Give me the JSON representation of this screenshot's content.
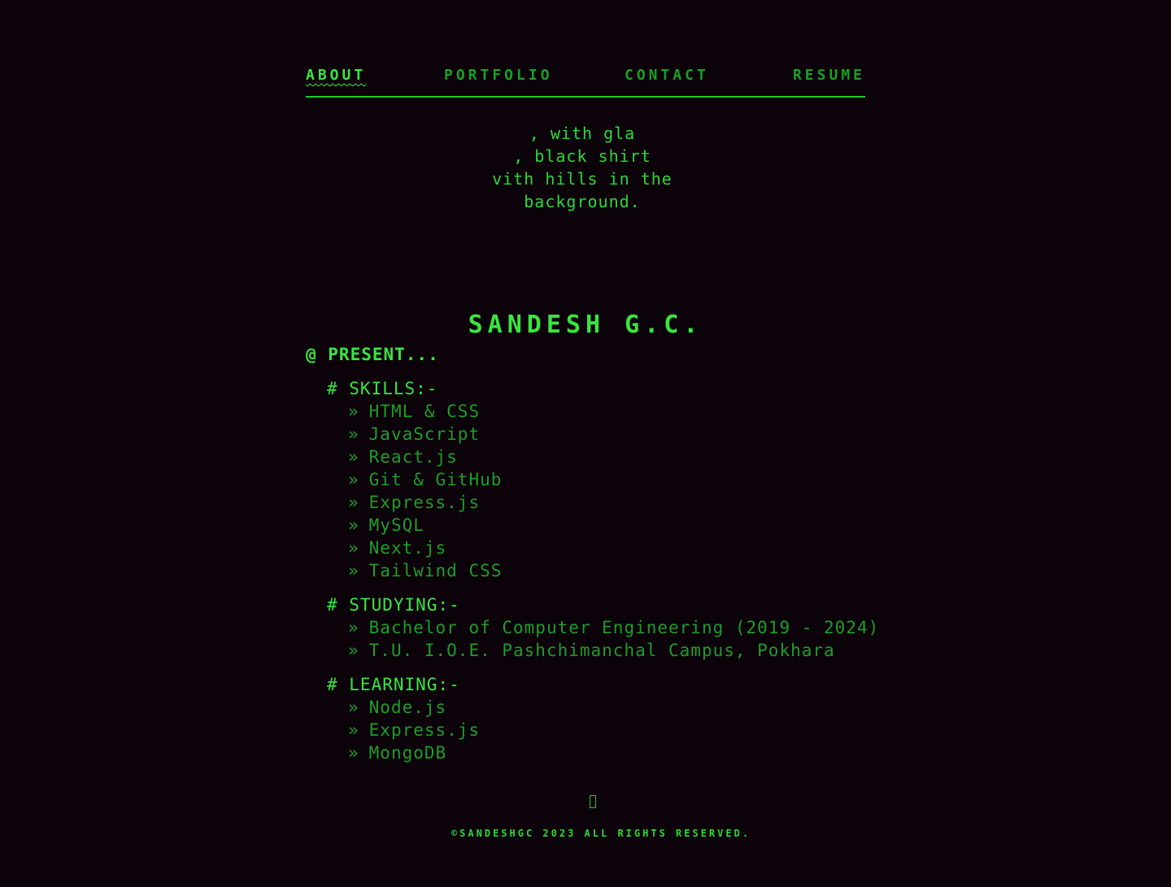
{
  "nav": {
    "items": [
      {
        "label": "ABOUT",
        "active": true
      },
      {
        "label": "PORTFOLIO",
        "active": false
      },
      {
        "label": "CONTACT",
        "active": false
      },
      {
        "label": "RESUME",
        "active": false
      }
    ]
  },
  "profile": {
    "image_alt_lines": [
      ", with gla",
      ", black shirt",
      "vith hills in the",
      "background."
    ],
    "name": "SANDESH G.C."
  },
  "present_heading": "@ PRESENT...",
  "skills": {
    "title": "# SKILLS:-",
    "items": [
      "HTML & CSS",
      "JavaScript",
      "React.js",
      "Git & GitHub",
      "Express.js",
      "MySQL",
      "Next.js",
      "Tailwind CSS"
    ]
  },
  "studying": {
    "title": "# STUDYING:-",
    "items": [
      "Bachelor of Computer Engineering (2019 - 2024)",
      "T.U. I.O.E. Pashchimanchal Campus, Pokhara"
    ]
  },
  "learning": {
    "title": "# LEARNING:-",
    "items": [
      "Node.js",
      "Express.js",
      "MongoDB"
    ]
  },
  "bullet": "»",
  "footer": {
    "icon": "broken-glyph-icon",
    "text": "©SANDESHGC 2023 ALL RIGHTS RESERVED."
  },
  "colors": {
    "background": "#0c020a",
    "accent": "#37e63f",
    "muted": "#1d9e26"
  }
}
